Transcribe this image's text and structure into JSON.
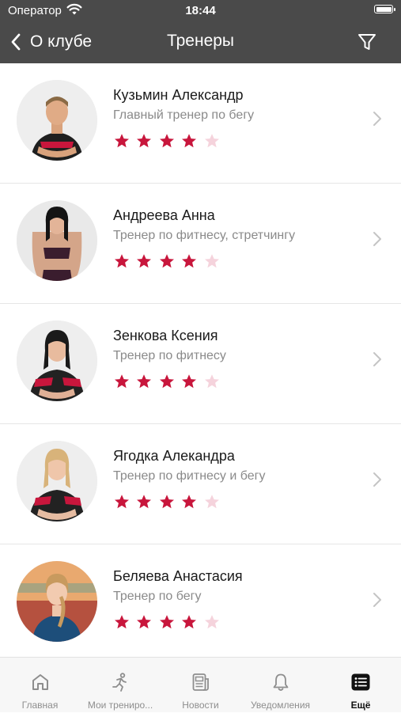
{
  "status_bar": {
    "carrier": "Оператор",
    "time": "18:44"
  },
  "nav": {
    "back_label": "О клубе",
    "title": "Тренеры"
  },
  "colors": {
    "accent": "#c8163c",
    "star_empty": "#f5d3dc",
    "bar": "#4a4a4a"
  },
  "trainers": [
    {
      "name": "Кузьмин Александр",
      "role": "Главный тренер по бегу",
      "rating": 4,
      "max_rating": 5
    },
    {
      "name": "Андреева Анна",
      "role": "Тренер по фитнесу, стретчингу",
      "rating": 4,
      "max_rating": 5
    },
    {
      "name": "Зенкова Ксения",
      "role": "Тренер по фитнесу",
      "rating": 4,
      "max_rating": 5
    },
    {
      "name": "Ягодка Алекандра",
      "role": "Тренер по фитнесу и бегу",
      "rating": 4,
      "max_rating": 5
    },
    {
      "name": "Беляева Анастасия",
      "role": "Тренер по бегу",
      "rating": 4,
      "max_rating": 5
    }
  ],
  "tabbar": {
    "items": [
      {
        "label": "Главная",
        "icon": "home-icon",
        "active": false
      },
      {
        "label": "Мои трениро...",
        "icon": "runner-icon",
        "active": false
      },
      {
        "label": "Новости",
        "icon": "news-icon",
        "active": false
      },
      {
        "label": "Уведомления",
        "icon": "bell-icon",
        "active": false
      },
      {
        "label": "Ещё",
        "icon": "more-list-icon",
        "active": true
      }
    ]
  }
}
